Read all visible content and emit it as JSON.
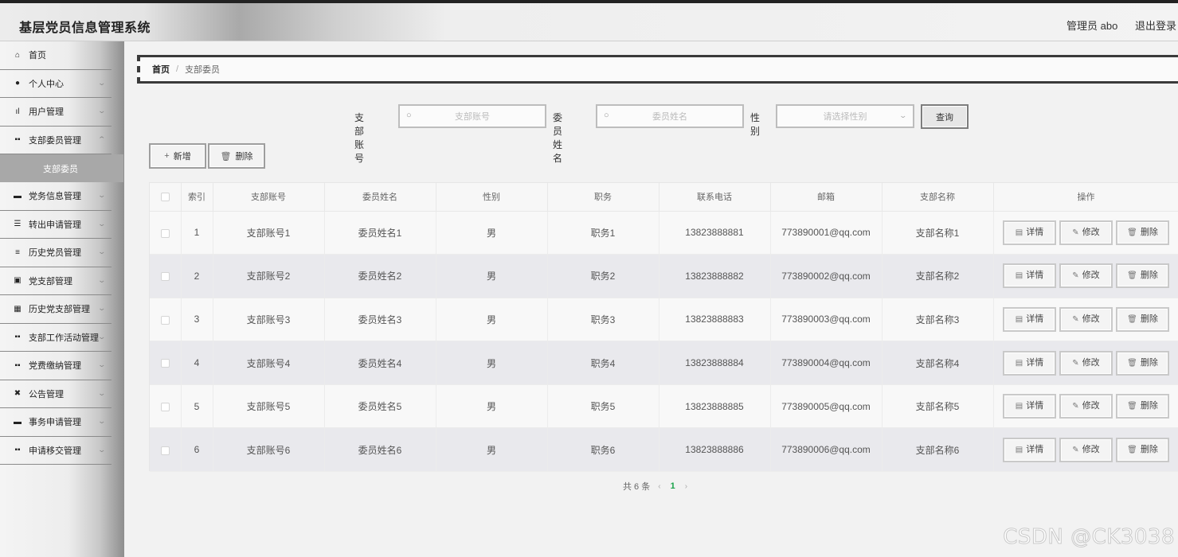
{
  "header": {
    "title": "基层党员信息管理系统",
    "user_label": "管理员 abo",
    "logout_label": "退出登录"
  },
  "sidebar": {
    "items": [
      {
        "label": "首页",
        "icon": "⌂"
      },
      {
        "label": "个人中心",
        "icon": "●"
      },
      {
        "label": "用户管理",
        "icon": "ıl"
      },
      {
        "label": "支部委员管理",
        "icon": "▪▪"
      },
      {
        "label": "党务信息管理",
        "icon": "▬"
      },
      {
        "label": "转出申请管理",
        "icon": "☰"
      },
      {
        "label": "历史党员管理",
        "icon": "≡"
      },
      {
        "label": "党支部管理",
        "icon": "▣"
      },
      {
        "label": "历史党支部管理",
        "icon": "▦"
      },
      {
        "label": "支部工作活动管理",
        "icon": "▪▪"
      },
      {
        "label": "党费缴纳管理",
        "icon": "▪▪"
      },
      {
        "label": "公告管理",
        "icon": "✖"
      },
      {
        "label": "事务申请管理",
        "icon": "▬"
      },
      {
        "label": "申请移交管理",
        "icon": "▪▪"
      }
    ],
    "sub_item": "支部委员"
  },
  "breadcrumb": {
    "home": "首页",
    "sep": "/",
    "current": "支部委员"
  },
  "search": {
    "account_label": "支部账号",
    "account_placeholder": "支部账号",
    "name_label": "委员姓名",
    "name_placeholder": "委员姓名",
    "gender_label": "性别",
    "gender_placeholder": "请选择性别",
    "query_label": "查询"
  },
  "actions": {
    "add_label": "新增",
    "delete_label": "删除"
  },
  "table": {
    "headers": [
      "索引",
      "支部账号",
      "委员姓名",
      "性别",
      "职务",
      "联系电话",
      "邮箱",
      "支部名称",
      "操作"
    ],
    "rows": [
      [
        "1",
        "支部账号1",
        "委员姓名1",
        "男",
        "职务1",
        "13823888881",
        "773890001@qq.com",
        "支部名称1"
      ],
      [
        "2",
        "支部账号2",
        "委员姓名2",
        "男",
        "职务2",
        "13823888882",
        "773890002@qq.com",
        "支部名称2"
      ],
      [
        "3",
        "支部账号3",
        "委员姓名3",
        "男",
        "职务3",
        "13823888883",
        "773890003@qq.com",
        "支部名称3"
      ],
      [
        "4",
        "支部账号4",
        "委员姓名4",
        "男",
        "职务4",
        "13823888884",
        "773890004@qq.com",
        "支部名称4"
      ],
      [
        "5",
        "支部账号5",
        "委员姓名5",
        "男",
        "职务5",
        "13823888885",
        "773890005@qq.com",
        "支部名称5"
      ],
      [
        "6",
        "支部账号6",
        "委员姓名6",
        "男",
        "职务6",
        "13823888886",
        "773890006@qq.com",
        "支部名称6"
      ]
    ],
    "row_buttons": [
      "详情",
      "修改",
      "删除"
    ]
  },
  "pagination": {
    "total_label": "共 6 条",
    "current_page": "1"
  },
  "watermark": "CSDN @CK3038"
}
